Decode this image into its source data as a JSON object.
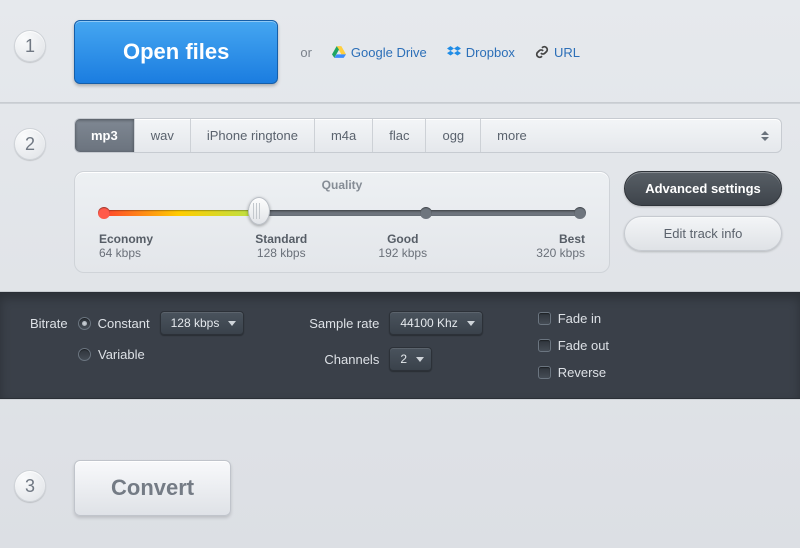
{
  "step1": {
    "number": "1",
    "open_label": "Open files",
    "or_label": "or",
    "gdrive_label": "Google Drive",
    "dropbox_label": "Dropbox",
    "url_label": "URL"
  },
  "step2": {
    "number": "2",
    "formats": {
      "mp3": "mp3",
      "wav": "wav",
      "ringtone": "iPhone ringtone",
      "m4a": "m4a",
      "flac": "flac",
      "ogg": "ogg",
      "more": "more"
    },
    "quality_title": "Quality",
    "levels": {
      "economy": {
        "name": "Economy",
        "rate": "64 kbps"
      },
      "standard": {
        "name": "Standard",
        "rate": "128 kbps"
      },
      "good": {
        "name": "Good",
        "rate": "192 kbps"
      },
      "best": {
        "name": "Best",
        "rate": "320 kbps"
      }
    },
    "adv_settings_label": "Advanced settings",
    "edit_track_label": "Edit track info"
  },
  "advanced": {
    "bitrate_label": "Bitrate",
    "constant_label": "Constant",
    "variable_label": "Variable",
    "bitrate_value": "128 kbps",
    "samplerate_label": "Sample rate",
    "samplerate_value": "44100 Khz",
    "channels_label": "Channels",
    "channels_value": "2",
    "fadein_label": "Fade in",
    "fadeout_label": "Fade out",
    "reverse_label": "Reverse"
  },
  "step3": {
    "number": "3",
    "convert_label": "Convert"
  },
  "colors": {
    "accent": "#2487e6",
    "dark_panel": "#3a4049"
  }
}
